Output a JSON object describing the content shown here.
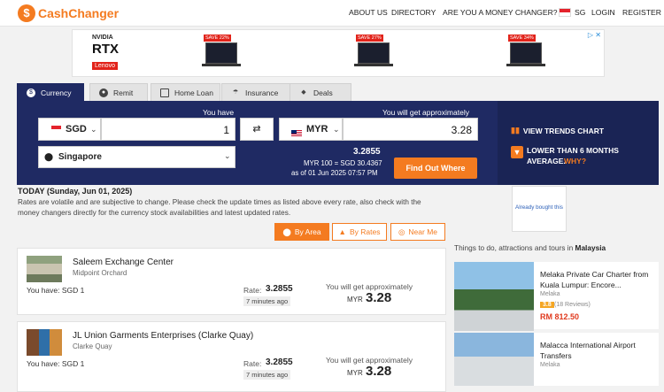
{
  "header": {
    "logo_icon": "$",
    "logo_text": "CashChanger",
    "nav": [
      "ABOUT US",
      "DIRECTORY",
      "ARE YOU A MONEY CHANGER?",
      "SG",
      "LOGIN",
      "REGISTER"
    ]
  },
  "ad": {
    "brand": "NVIDIA",
    "product": "RTX",
    "maker": "Lenovo",
    "badges": [
      "SAVE 22%",
      "SAVE 27%",
      "SAVE 34%"
    ],
    "controls": "▷ ✕"
  },
  "tabs": [
    {
      "label": "Currency",
      "icon": "dollar-icon"
    },
    {
      "label": "Remit",
      "icon": "globe-icon"
    },
    {
      "label": "Home Loan",
      "icon": "house-icon"
    },
    {
      "label": "Insurance",
      "icon": "umbrella-icon"
    },
    {
      "label": "Deals",
      "icon": "tag-icon"
    }
  ],
  "calculator": {
    "you_have_label": "You have",
    "you_get_label": "You will get approximately",
    "from_currency": "SGD",
    "from_amount": "1",
    "to_currency": "MYR",
    "to_amount": "3.28",
    "swap_icon": "⇄",
    "location": "Singapore",
    "rate": "3.2855",
    "rate_detail": "MYR 100 = SGD 30.4367",
    "rate_date": "as of 01 Jun 2025 07:57 PM",
    "find_button": "Find Out Where"
  },
  "trends": {
    "chart_link": "VIEW TRENDS CHART",
    "lower_text": "LOWER THAN 6 MONTHS",
    "average_text": "AVERAGE.",
    "why_link": "WHY?"
  },
  "today": "TODAY (Sunday, Jun 01, 2025)",
  "disclaimer": "Rates are volatile and are subjective to change. Please check the update times as listed above every rate, also check with the money changers directly for the currency stock availabilities and latest updated rates.",
  "affiliate": "Already bought this",
  "sort": {
    "by_area": "By Area",
    "by_rates": "By Rates",
    "near_me": "Near Me"
  },
  "results": [
    {
      "name": "Saleem Exchange Center",
      "location": "Midpoint Orchard",
      "you_have": "You have: SGD 1",
      "rate_label": "Rate:",
      "rate": "3.2855",
      "updated": "7 minutes ago",
      "get_label": "You will get approximately",
      "currency": "MYR",
      "amount": "3.28"
    },
    {
      "name": "JL Union Garments Enterprises (Clarke Quay)",
      "location": "Clarke Quay",
      "you_have": "You have: SGD 1",
      "rate_label": "Rate:",
      "rate": "3.2855",
      "updated": "7 minutes ago",
      "get_label": "You will get approximately",
      "currency": "MYR",
      "amount": "3.28"
    }
  ],
  "sidebar": {
    "things_prefix": "Things to do, attractions and tours in",
    "things_place": "Malaysia",
    "tours": [
      {
        "title": "Melaka Private Car Charter from Kuala Lumpur: Encore...",
        "place": "Melaka",
        "score": "3.8",
        "reviews": "(18 Reviews)",
        "price": "RM 812.50"
      },
      {
        "title": "Malacca International Airport Transfers",
        "place": "Melaka"
      }
    ]
  },
  "colors": {
    "navy": "#1f2a63",
    "orange": "#f47b20",
    "price_red": "#e03a1e"
  }
}
